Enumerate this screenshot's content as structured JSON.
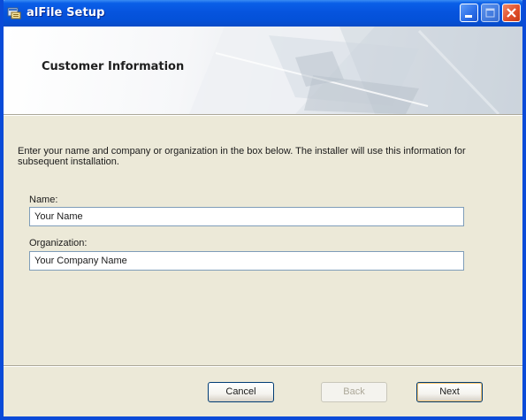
{
  "window": {
    "title": "alFile Setup",
    "title_bar_color": "#0454d8"
  },
  "banner": {
    "heading": "Customer Information"
  },
  "form": {
    "description": "Enter your name and company or organization in the box below. The installer will use this information for subsequent installation.",
    "name_label": "Name:",
    "name_value": "Your Name",
    "organization_label": "Organization:",
    "organization_value": "Your Company Name"
  },
  "buttons": {
    "cancel_label": "Cancel",
    "back_label": "Back",
    "next_label": "Next"
  },
  "icons": {
    "app": "setup-icon",
    "minimize": "minimize-icon",
    "maximize": "maximize-icon",
    "close": "close-icon"
  }
}
